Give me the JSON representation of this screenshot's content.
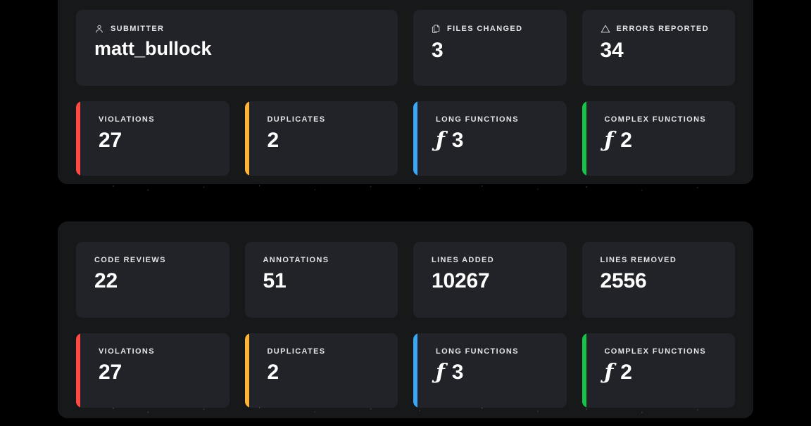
{
  "panels": [
    {
      "id": "submission-summary-panel",
      "primary_cards": [
        {
          "icon": "user-icon",
          "label": "SUBMITTER",
          "value": "matt_bullock",
          "is_name": true
        },
        {
          "icon": "copy-icon",
          "label": "FILES CHANGED",
          "value": "3"
        },
        {
          "icon": "warning-triangle-icon",
          "label": "ERRORS REPORTED",
          "value": "34"
        }
      ],
      "accent_cards": [
        {
          "label": "VIOLATIONS",
          "value": "27",
          "accent": "#ff4a43",
          "glyph": ""
        },
        {
          "label": "DUPLICATES",
          "value": "2",
          "accent": "#fcb43b",
          "glyph": ""
        },
        {
          "label": "LONG FUNCTIONS",
          "value": "3",
          "accent": "#3aa9f5",
          "glyph": "ƒ"
        },
        {
          "label": "COMPLEX FUNCTIONS",
          "value": "2",
          "accent": "#17c44a",
          "glyph": "ƒ"
        }
      ]
    },
    {
      "id": "review-activity-panel",
      "primary_cards": [
        {
          "icon": "",
          "label": "CODE REVIEWS",
          "value": "22"
        },
        {
          "icon": "",
          "label": "ANNOTATIONS",
          "value": "51"
        },
        {
          "icon": "",
          "label": "LINES ADDED",
          "value": "10267"
        },
        {
          "icon": "",
          "label": "LINES REMOVED",
          "value": "2556"
        }
      ],
      "accent_cards": [
        {
          "label": "VIOLATIONS",
          "value": "27",
          "accent": "#ff4a43",
          "glyph": ""
        },
        {
          "label": "DUPLICATES",
          "value": "2",
          "accent": "#fcb43b",
          "glyph": ""
        },
        {
          "label": "LONG FUNCTIONS",
          "value": "3",
          "accent": "#3aa9f5",
          "glyph": "ƒ"
        },
        {
          "label": "COMPLEX FUNCTIONS",
          "value": "2",
          "accent": "#17c44a",
          "glyph": "ƒ"
        }
      ]
    }
  ],
  "colors": {
    "page_background": "#000000",
    "panel_background": "#17181a",
    "card_background": "#212328",
    "label_text": "#e2e4e8",
    "value_text": "#ffffff",
    "accent_red": "#ff4a43",
    "accent_amber": "#fcb43b",
    "accent_blue": "#3aa9f5",
    "accent_green": "#17c44a"
  }
}
